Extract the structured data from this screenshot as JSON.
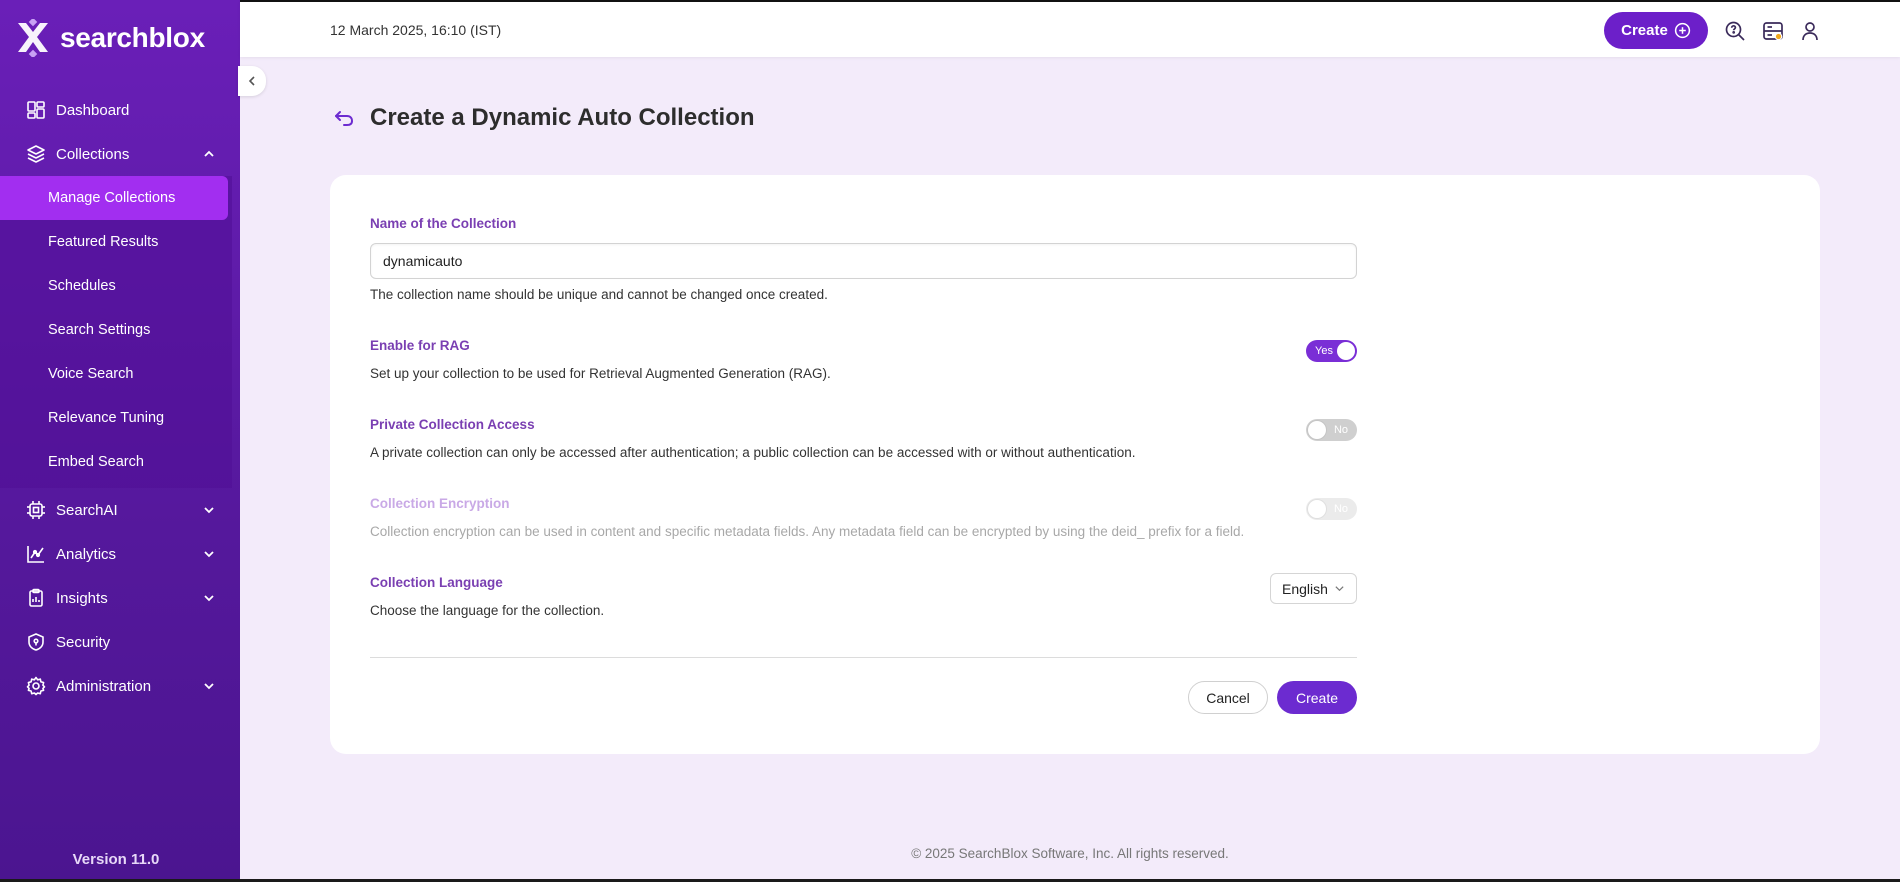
{
  "brand": {
    "name": "searchblox",
    "accent": "#6c1fc9",
    "sidebar_color": "#5a1ba3"
  },
  "topbar": {
    "datetime": "12 March 2025, 16:10 (IST)",
    "create_label": "Create",
    "icons": [
      "help-search-icon",
      "server-status-icon",
      "user-icon"
    ]
  },
  "sidebar": {
    "items": [
      {
        "label": "Dashboard",
        "icon": "dashboard-icon"
      },
      {
        "label": "Collections",
        "icon": "layers-icon",
        "expanded": true
      },
      {
        "label": "SearchAI",
        "icon": "chip-icon"
      },
      {
        "label": "Analytics",
        "icon": "analytics-icon"
      },
      {
        "label": "Insights",
        "icon": "insights-icon"
      },
      {
        "label": "Security",
        "icon": "shield-icon"
      },
      {
        "label": "Administration",
        "icon": "gear-icon"
      }
    ],
    "collections_sub": [
      {
        "label": "Manage Collections",
        "active": true
      },
      {
        "label": "Featured Results"
      },
      {
        "label": "Schedules"
      },
      {
        "label": "Search Settings"
      },
      {
        "label": "Voice Search"
      },
      {
        "label": "Relevance Tuning"
      },
      {
        "label": "Embed Search"
      }
    ],
    "version": "Version 11.0"
  },
  "page": {
    "title": "Create a Dynamic Auto Collection"
  },
  "form": {
    "name": {
      "label": "Name of the Collection",
      "value": "dynamicauto",
      "help": "The collection name should be unique and cannot be changed once created."
    },
    "rag": {
      "label": "Enable for RAG",
      "help": "Set up your collection to be used for Retrieval Augmented Generation (RAG).",
      "state": "Yes"
    },
    "private": {
      "label": "Private Collection Access",
      "help": "A private collection can only be accessed after authentication; a public collection can be accessed with or without authentication.",
      "state": "No"
    },
    "encryption": {
      "label": "Collection Encryption",
      "help": "Collection encryption can be used in content and specific metadata fields. Any metadata field can be encrypted by using the deid_ prefix for a field.",
      "state": "No"
    },
    "language": {
      "label": "Collection Language",
      "help": "Choose the language for the collection.",
      "selected": "English"
    },
    "cancel_label": "Cancel",
    "create_label": "Create"
  },
  "footer": "© 2025 SearchBlox Software, Inc. All rights reserved."
}
